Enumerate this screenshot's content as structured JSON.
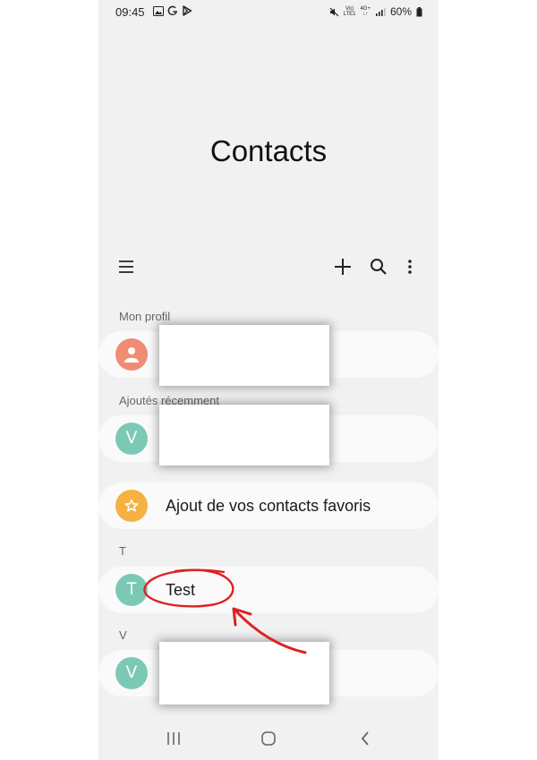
{
  "status_bar": {
    "time": "09:45",
    "battery_text": "60%",
    "network_top": "Vo)",
    "network_bottom": "LTE1",
    "signal_top": "4G+",
    "left_icons": [
      "image-icon",
      "google-icon",
      "play-store-icon"
    ],
    "right_icons": [
      "mute-icon",
      "signal-icon",
      "battery-icon"
    ]
  },
  "header": {
    "title": "Contacts"
  },
  "toolbar": {
    "menu_icon": "hamburger-icon",
    "add_icon": "plus-icon",
    "search_icon": "search-icon",
    "more_icon": "more-vertical-icon"
  },
  "sections": {
    "my_profile": "Mon profil",
    "recently_added": "Ajoutés récemment",
    "letter_t": "T",
    "letter_v": "V"
  },
  "contacts": {
    "recent_avatar_letter": "V",
    "favorites_label": "Ajout de vos contacts favoris",
    "t_avatar_letter": "T",
    "t_name": "Test",
    "v_avatar_letter": "V"
  },
  "colors": {
    "background": "#f1f1f1",
    "card": "#fafafa",
    "profile_avatar": "#f08c74",
    "teal_avatar": "#7bc9b5",
    "favorites_avatar": "#f5b142",
    "annotation": "#e02020"
  },
  "nav_bar": {
    "icons": [
      "recents-icon",
      "home-icon",
      "back-icon"
    ]
  }
}
